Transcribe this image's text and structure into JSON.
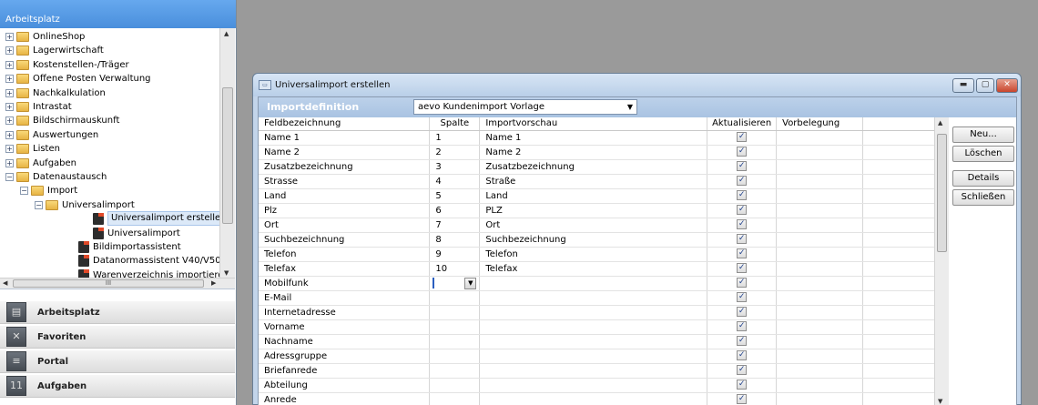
{
  "workspace": {
    "header": "Arbeitsplatz",
    "tree": [
      {
        "label": "OnlineShop",
        "level": 0,
        "exp": "+",
        "icon": "folder"
      },
      {
        "label": "Lagerwirtschaft",
        "level": 0,
        "exp": "+",
        "icon": "folder"
      },
      {
        "label": "Kostenstellen-/Träger",
        "level": 0,
        "exp": "+",
        "icon": "folder"
      },
      {
        "label": "Offene Posten Verwaltung",
        "level": 0,
        "exp": "+",
        "icon": "folder"
      },
      {
        "label": "Nachkalkulation",
        "level": 0,
        "exp": "+",
        "icon": "folder"
      },
      {
        "label": "Intrastat",
        "level": 0,
        "exp": "+",
        "icon": "folder"
      },
      {
        "label": "Bildschirmauskunft",
        "level": 0,
        "exp": "+",
        "icon": "folder"
      },
      {
        "label": "Auswertungen",
        "level": 0,
        "exp": "+",
        "icon": "folder"
      },
      {
        "label": "Listen",
        "level": 0,
        "exp": "+",
        "icon": "folder"
      },
      {
        "label": "Aufgaben",
        "level": 0,
        "exp": "+",
        "icon": "folder"
      },
      {
        "label": "Datenaustausch",
        "level": 0,
        "exp": "-",
        "icon": "folder"
      },
      {
        "label": "Import",
        "level": 1,
        "exp": "-",
        "icon": "folder"
      },
      {
        "label": "Universalimport",
        "level": 2,
        "exp": "-",
        "icon": "folder"
      },
      {
        "label": "Universalimport erstellen",
        "level": 3,
        "exp": "",
        "icon": "doc",
        "selected": true
      },
      {
        "label": "Universalimport",
        "level": 3,
        "exp": "",
        "icon": "doc"
      },
      {
        "label": "Bildimportassistent",
        "level": 2,
        "exp": "",
        "icon": "doc"
      },
      {
        "label": "Datanormassistent V40/V50",
        "level": 2,
        "exp": "",
        "icon": "doc"
      },
      {
        "label": "Warenverzeichnis importieren",
        "level": 2,
        "exp": "",
        "icon": "doc"
      }
    ],
    "hscroll_grip": "III",
    "nav": [
      {
        "label": "Arbeitsplatz",
        "icon": "workspace-icon",
        "glyph": "▤"
      },
      {
        "label": "Favoriten",
        "icon": "favorites-icon",
        "glyph": "✕"
      },
      {
        "label": "Portal",
        "icon": "portal-icon",
        "glyph": "≡"
      },
      {
        "label": "Aufgaben",
        "icon": "calendar-icon",
        "glyph": "11"
      }
    ]
  },
  "dialog": {
    "title": "Universalimport erstellen",
    "import_label": "Importdefinition",
    "import_value": "aevo Kundenimport Vorlage",
    "columns": [
      "Feldbezeichnung",
      "Spalte",
      "Importvorschau",
      "Aktualisieren",
      "Vorbelegung"
    ],
    "rows": [
      {
        "field": "Name 1",
        "col": "1",
        "preview": "Name 1",
        "update": true
      },
      {
        "field": "Name 2",
        "col": "2",
        "preview": "Name 2",
        "update": true
      },
      {
        "field": "Zusatzbezeichnung",
        "col": "3",
        "preview": "Zusatzbezeichnung",
        "update": true
      },
      {
        "field": "Strasse",
        "col": "4",
        "preview": "Straße",
        "update": true
      },
      {
        "field": "Land",
        "col": "5",
        "preview": "Land",
        "update": true
      },
      {
        "field": "Plz",
        "col": "6",
        "preview": "PLZ",
        "update": true
      },
      {
        "field": "Ort",
        "col": "7",
        "preview": "Ort",
        "update": true
      },
      {
        "field": "Suchbezeichnung",
        "col": "8",
        "preview": "Suchbezeichnung",
        "update": true
      },
      {
        "field": "Telefon",
        "col": "9",
        "preview": "Telefon",
        "update": true
      },
      {
        "field": "Telefax",
        "col": "10",
        "preview": "Telefax",
        "update": true
      },
      {
        "field": "Mobilfunk",
        "col": "",
        "preview": "",
        "update": true,
        "editing": true
      },
      {
        "field": "E-Mail",
        "col": "",
        "preview": "",
        "update": true
      },
      {
        "field": "Internetadresse",
        "col": "",
        "preview": "",
        "update": true
      },
      {
        "field": "Vorname",
        "col": "",
        "preview": "",
        "update": true
      },
      {
        "field": "Nachname",
        "col": "",
        "preview": "",
        "update": true
      },
      {
        "field": "Adressgruppe",
        "col": "",
        "preview": "",
        "update": true
      },
      {
        "field": "Briefanrede",
        "col": "",
        "preview": "",
        "update": true
      },
      {
        "field": "Abteilung",
        "col": "",
        "preview": "",
        "update": true
      },
      {
        "field": "Anrede",
        "col": "",
        "preview": "",
        "update": true
      }
    ],
    "buttons": {
      "new": "Neu...",
      "delete": "Löschen",
      "details": "Details",
      "close": "Schließen"
    }
  }
}
